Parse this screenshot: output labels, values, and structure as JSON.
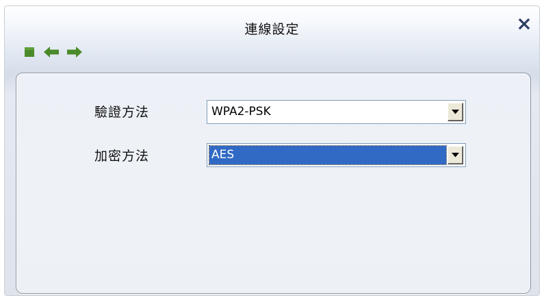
{
  "window": {
    "title": "連線設定"
  },
  "toolbar": {
    "buttons": [
      {
        "icon": "stop-icon",
        "color": "#4a8a2a"
      },
      {
        "icon": "back-arrow-icon",
        "color": "#4a8a2a"
      },
      {
        "icon": "forward-arrow-icon",
        "color": "#4a8a2a"
      }
    ]
  },
  "form": {
    "auth_label": "驗證方法",
    "auth_value": "WPA2-PSK",
    "encryption_label": "加密方法",
    "encryption_value": "AES"
  },
  "colors": {
    "accent_green": "#4a8a2a",
    "selection_blue": "#316ac5",
    "close_blue": "#2c3e63"
  }
}
